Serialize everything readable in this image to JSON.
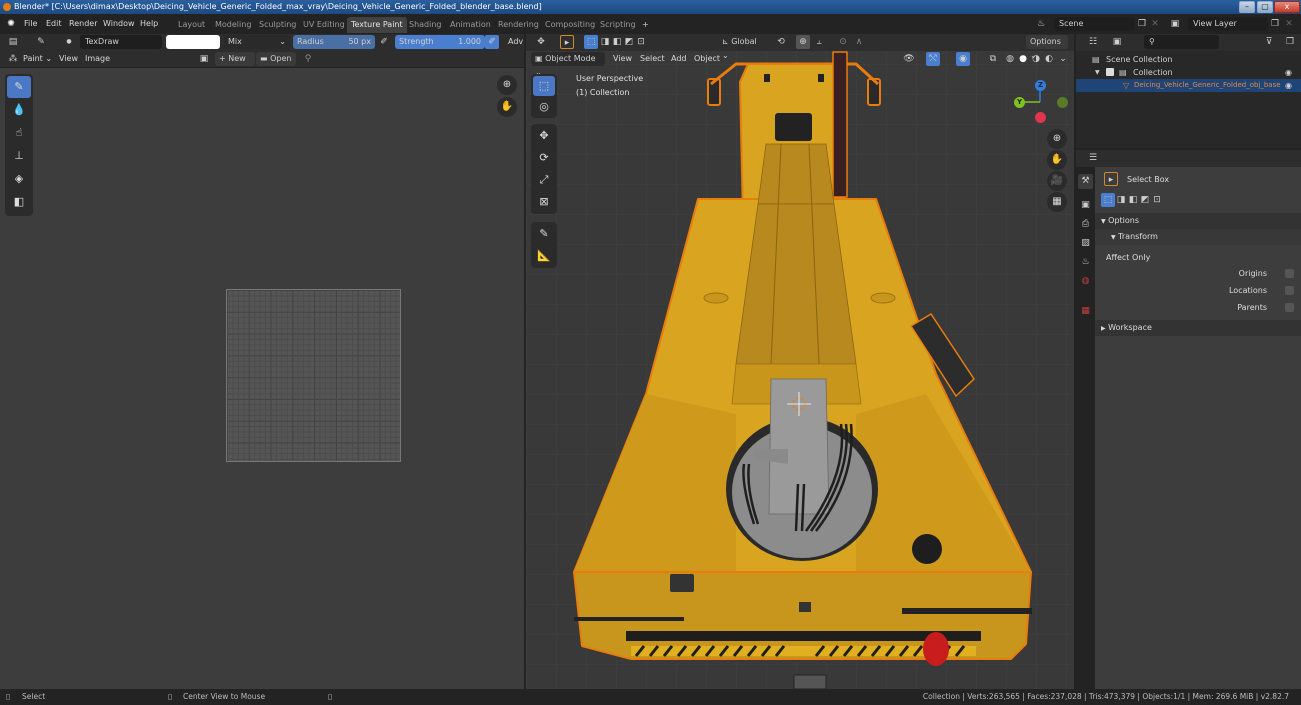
{
  "window": {
    "title": "Blender* [C:\\Users\\dimax\\Desktop\\Deicing_Vehicle_Generic_Folded_max_vray\\Deicing_Vehicle_Generic_Folded_blender_base.blend]",
    "minimize": "–",
    "maximize": "▢",
    "close": "x"
  },
  "menu": [
    "File",
    "Edit",
    "Render",
    "Window",
    "Help"
  ],
  "workspaces": [
    {
      "label": "Layout",
      "active": false
    },
    {
      "label": "Modeling",
      "active": false
    },
    {
      "label": "Sculpting",
      "active": false
    },
    {
      "label": "UV Editing",
      "active": false
    },
    {
      "label": "Texture Paint",
      "active": true
    },
    {
      "label": "Shading",
      "active": false
    },
    {
      "label": "Animation",
      "active": false
    },
    {
      "label": "Rendering",
      "active": false
    },
    {
      "label": "Compositing",
      "active": false
    },
    {
      "label": "Scripting",
      "active": false
    }
  ],
  "add_workspace": "+",
  "scene": {
    "label": "Scene",
    "view_layer": "View Layer"
  },
  "image_editor": {
    "brush_name": "TexDraw",
    "color_swatch": "#ffffff",
    "blend_mode": "Mix",
    "radius_label": "Radius",
    "radius_value": "50 px",
    "strength_label": "Strength",
    "strength_value": "1.000",
    "advanced_label": "Adv",
    "mode": "Paint",
    "view_menu": "View",
    "image_menu": "Image",
    "new_label": "New",
    "open_label": "Open",
    "tools": [
      "brush-icon",
      "soften-icon",
      "smear-icon",
      "clone-icon",
      "fill-icon",
      "mask-icon"
    ]
  },
  "viewport": {
    "transform_orientation": "Global",
    "options_label": "Options",
    "mode": "Object Mode",
    "menus": [
      "View",
      "Select",
      "Add",
      "Object"
    ],
    "perspective": "User Perspective",
    "collection": "(1) Collection",
    "gizmo": {
      "z": "Z",
      "y": "Y",
      "z_color": "#2f7fe0",
      "y_color": "#7fc31f",
      "x_color": "#e0344f"
    },
    "accent_color": "#e87d0d",
    "vehicle_color": "#d9a520"
  },
  "outliner": {
    "scene_collection": "Scene Collection",
    "collection": "Collection",
    "object": "Deicing_Vehicle_Generic_Folded_obj_base",
    "object_color": "#e0894a"
  },
  "properties": {
    "tool_name": "Select Box",
    "options_label": "Options",
    "transform_label": "Transform",
    "affect_only_label": "Affect Only",
    "origins_label": "Origins",
    "locations_label": "Locations",
    "parents_label": "Parents",
    "workspace_label": "Workspace"
  },
  "statusbar": {
    "select": "Select",
    "center_view": "Center View to Mouse",
    "stats": "Collection | Verts:263,565 | Faces:237,028 | Tris:473,379 | Objects:1/1 | Mem: 269.6 MiB | v2.82.7"
  }
}
